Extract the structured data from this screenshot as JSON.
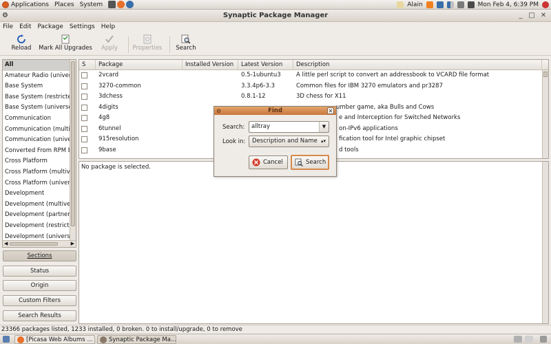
{
  "top_panel": {
    "menus": [
      "Applications",
      "Places",
      "System"
    ],
    "user": "Alain",
    "clock": "Mon Feb  4,  6:39 PM"
  },
  "window": {
    "title": "Synaptic Package Manager"
  },
  "menubar": [
    "File",
    "Edit",
    "Package",
    "Settings",
    "Help"
  ],
  "toolbar": {
    "reload": "Reload",
    "mark_all": "Mark All Upgrades",
    "apply": "Apply",
    "properties": "Properties",
    "search": "Search"
  },
  "sections": [
    "All",
    "Amateur Radio (universe)",
    "Base System",
    "Base System (restricted)",
    "Base System (universe)",
    "Communication",
    "Communication (multiverse)",
    "Communication (universe)",
    "Converted From RPM by Alien",
    "Cross Platform",
    "Cross Platform (multiverse)",
    "Cross Platform (universe)",
    "Development",
    "Development (multiverse)",
    "Development (partner)",
    "Development (restricted)",
    "Development (universe)"
  ],
  "filter_buttons": {
    "sections": "Sections",
    "status": "Status",
    "origin": "Origin",
    "custom_filters": "Custom Filters",
    "search_results": "Search Results"
  },
  "table": {
    "headers": {
      "s": "S",
      "package": "Package",
      "installed": "Installed Version",
      "latest": "Latest Version",
      "description": "Description"
    },
    "rows": [
      {
        "package": "2vcard",
        "installed": "",
        "latest": "0.5-1ubuntu3",
        "description": "A little perl script to convert an addressbook to VCARD file format"
      },
      {
        "package": "3270-common",
        "installed": "",
        "latest": "3.3.4p6-3.3",
        "description": "Common files for IBM 3270 emulators and pr3287"
      },
      {
        "package": "3dchess",
        "installed": "",
        "latest": "0.8.1-12",
        "description": "3D chess for X11"
      },
      {
        "package": "4digits",
        "installed": "",
        "latest": "",
        "description": "umber game, aka Bulls and Cows"
      },
      {
        "package": "4g8",
        "installed": "",
        "latest": "",
        "description": "e and Interception for Switched Networks"
      },
      {
        "package": "6tunnel",
        "installed": "",
        "latest": "",
        "description": "on-IPv6 applications"
      },
      {
        "package": "915resolution",
        "installed": "",
        "latest": "",
        "description": "fication tool for Intel graphic chipset"
      },
      {
        "package": "9base",
        "installed": "",
        "latest": "",
        "description": "d tools"
      }
    ]
  },
  "description_pane": {
    "text": "No package is selected."
  },
  "status_bar": "23366 packages listed, 1233 installed, 0 broken. 0 to install/upgrade, 0 to remove",
  "taskbar": [
    {
      "label": "[Picasa Web Albums ..."
    },
    {
      "label": "Synaptic Package Ma..."
    }
  ],
  "find_dialog": {
    "title": "Find",
    "search_label": "Search:",
    "search_value": "alltray",
    "look_in_label": "Look in:",
    "look_in_value": "Description and Name",
    "cancel": "Cancel",
    "search_button": "Search"
  },
  "colors": {
    "dialog_title": "#c8763e",
    "ubuntu": "#d95c20"
  }
}
